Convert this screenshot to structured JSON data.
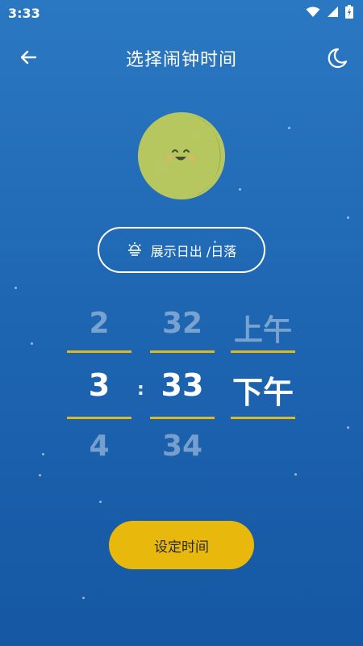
{
  "status_bar": {
    "time": "3:33"
  },
  "header": {
    "title": "选择闹钟时间"
  },
  "sun_button": {
    "label": "展示日出 /日落"
  },
  "picker": {
    "hours": {
      "prev": "2",
      "selected": "3",
      "next": "4"
    },
    "separator": ":",
    "minutes": {
      "prev": "32",
      "selected": "33",
      "next": "34"
    },
    "ampm": {
      "prev": "上午",
      "selected": "下午"
    }
  },
  "set_button": {
    "label": "设定时间"
  },
  "colors": {
    "accent": "#e9b80d",
    "background_top": "#2b78c2",
    "background_bottom": "#1557a3"
  },
  "icons": [
    "wifi-icon",
    "signal-icon",
    "battery-icon",
    "back-arrow-icon",
    "moon-night-icon",
    "moon-face-icon",
    "sunrise-icon"
  ]
}
